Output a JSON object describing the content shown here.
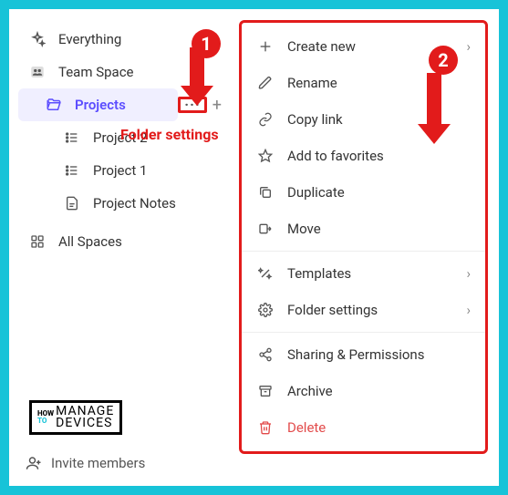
{
  "sidebar": {
    "everything": "Everything",
    "team_space": "Team Space",
    "projects": "Projects",
    "project2": "Project 2",
    "project1": "Project 1",
    "project_notes": "Project Notes",
    "all_spaces": "All Spaces",
    "invite": "Invite members"
  },
  "annotations": {
    "folder_settings_label": "Folder settings",
    "marker1": "1",
    "marker2": "2"
  },
  "menu": {
    "create_new": "Create new",
    "rename": "Rename",
    "copy_link": "Copy link",
    "add_favorites": "Add to favorites",
    "duplicate": "Duplicate",
    "move": "Move",
    "templates": "Templates",
    "folder_settings": "Folder settings",
    "sharing": "Sharing & Permissions",
    "archive": "Archive",
    "delete": "Delete"
  },
  "logo": {
    "how": "HOW",
    "to": "TO",
    "manage": "MANAGE",
    "devices": "DEVICES"
  }
}
